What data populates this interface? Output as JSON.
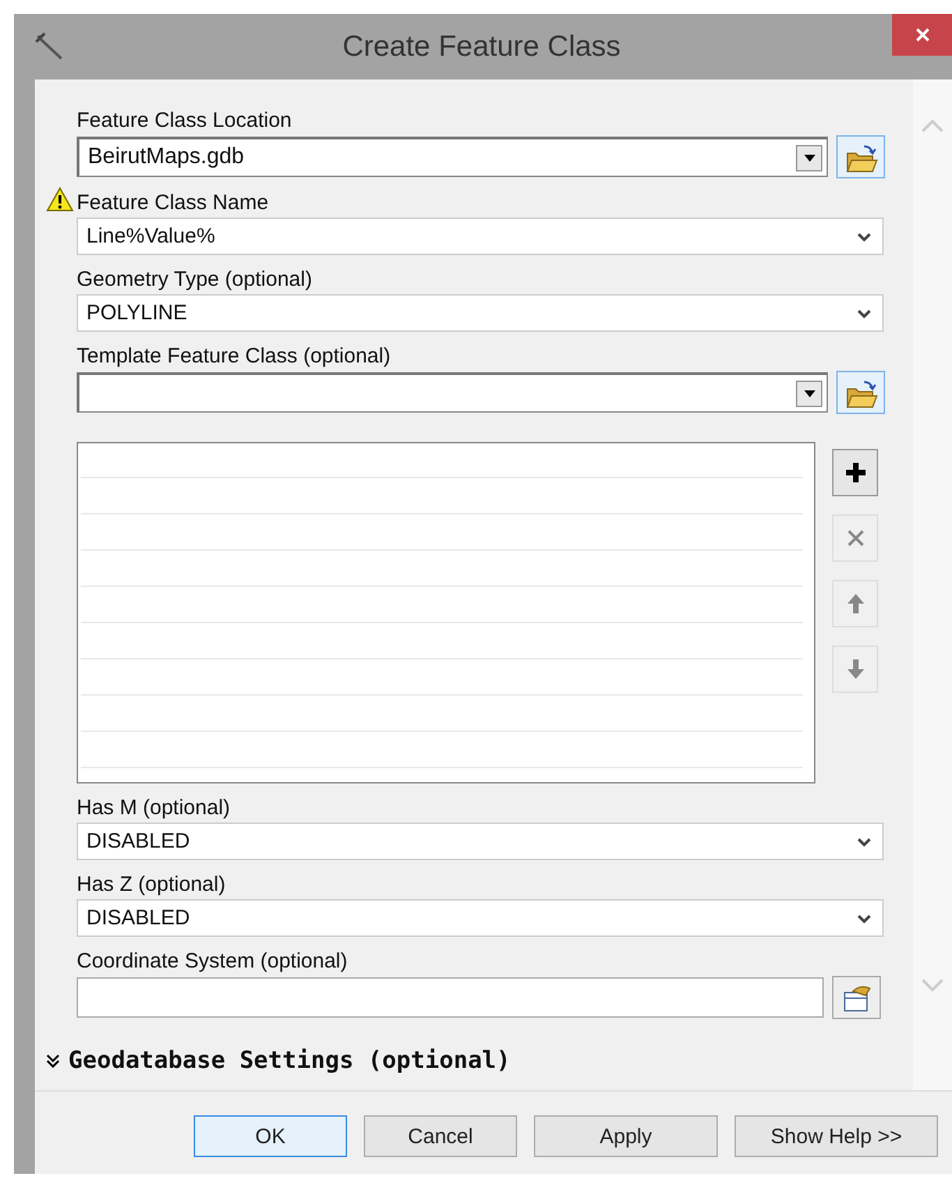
{
  "window": {
    "title": "Create Feature Class"
  },
  "parameters": [
    {
      "kind": "combo",
      "label": "Feature Class Location",
      "value": "BeirutMaps.gdb",
      "warning": false
    },
    {
      "kind": "dropdown",
      "label": "Feature Class Name",
      "value": "Line%Value%",
      "warning": true
    },
    {
      "kind": "dropdown",
      "label": "Geometry Type (optional)",
      "value": "POLYLINE",
      "warning": false
    },
    {
      "kind": "combo",
      "label": "Template Feature Class (optional)",
      "warning": false
    },
    {
      "kind": "list",
      "buttons": [
        {
          "kind": "add",
          "disabled": false
        },
        {
          "kind": "remove",
          "disabled": true
        },
        {
          "kind": "up",
          "disabled": true
        },
        {
          "kind": "down",
          "disabled": true
        }
      ]
    },
    {
      "kind": "dropdown",
      "label": "Has M (optional)",
      "value": "DISABLED",
      "warning": false
    },
    {
      "kind": "dropdown",
      "label": "Has Z (optional)",
      "value": "DISABLED",
      "warning": false
    },
    {
      "kind": "spatial",
      "label": "Coordinate System (optional)",
      "warning": false
    }
  ],
  "section": {
    "label": "Geodatabase Settings (optional)",
    "expanded": false
  },
  "buttons": [
    {
      "label": "OK",
      "default": true
    },
    {
      "label": "Cancel",
      "default": false
    },
    {
      "label": "Apply",
      "default": false
    },
    {
      "label": "Show Help >>",
      "default": false
    }
  ]
}
